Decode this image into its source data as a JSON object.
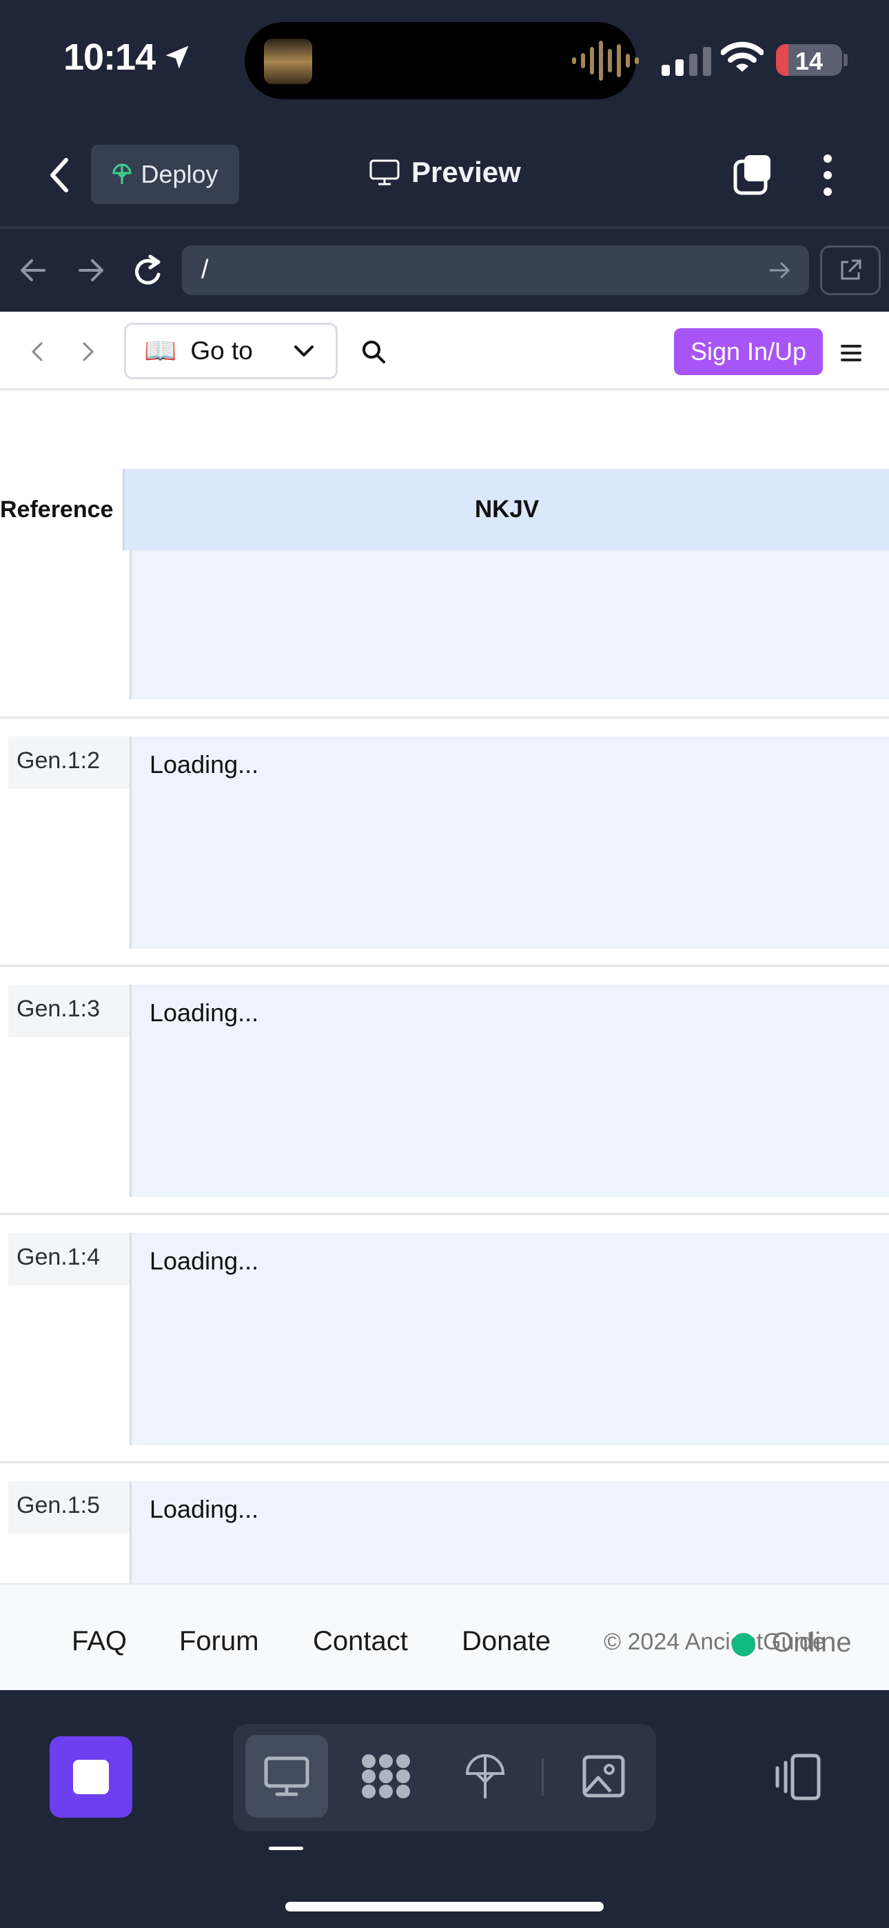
{
  "status_bar": {
    "time": "10:14",
    "battery": "14"
  },
  "app_header": {
    "deploy_label": "Deploy",
    "preview_label": "Preview"
  },
  "browser": {
    "url": "/"
  },
  "site": {
    "goto_label": "Go to",
    "book_glyph": "📖",
    "signin_label": "Sign In/Up",
    "columns": {
      "reference": "Reference",
      "version": "NKJV"
    },
    "verses": [
      {
        "ref": "Gen.1:2",
        "text": "Loading..."
      },
      {
        "ref": "Gen.1:3",
        "text": "Loading..."
      },
      {
        "ref": "Gen.1:4",
        "text": "Loading..."
      },
      {
        "ref": "Gen.1:5",
        "text": "Loading..."
      }
    ],
    "footer": {
      "links": [
        "FAQ",
        "Forum",
        "Contact",
        "Donate"
      ],
      "copyright": "© 2024 AncientGuide",
      "online_label": "Online"
    }
  },
  "colors": {
    "accent_purple": "#a855f7",
    "stop_button": "#6d3ff0",
    "online_green": "#12b981",
    "version_header": "#dbe8fc"
  },
  "icons": [
    "location-arrow-icon",
    "signal-icon",
    "wifi-icon",
    "battery-icon",
    "back-chevron-icon",
    "deploy-icon",
    "monitor-icon",
    "tabs-icon",
    "more-vertical-icon",
    "browser-back-icon",
    "browser-forward-icon",
    "reload-icon",
    "go-arrow-icon",
    "external-link-icon",
    "chevron-left-icon",
    "chevron-right-icon",
    "book-icon",
    "chevron-down-icon",
    "search-icon",
    "menu-icon",
    "stop-icon",
    "desktop-icon",
    "apps-icon",
    "deploy-icon",
    "image-icon",
    "rotate-device-icon"
  ]
}
